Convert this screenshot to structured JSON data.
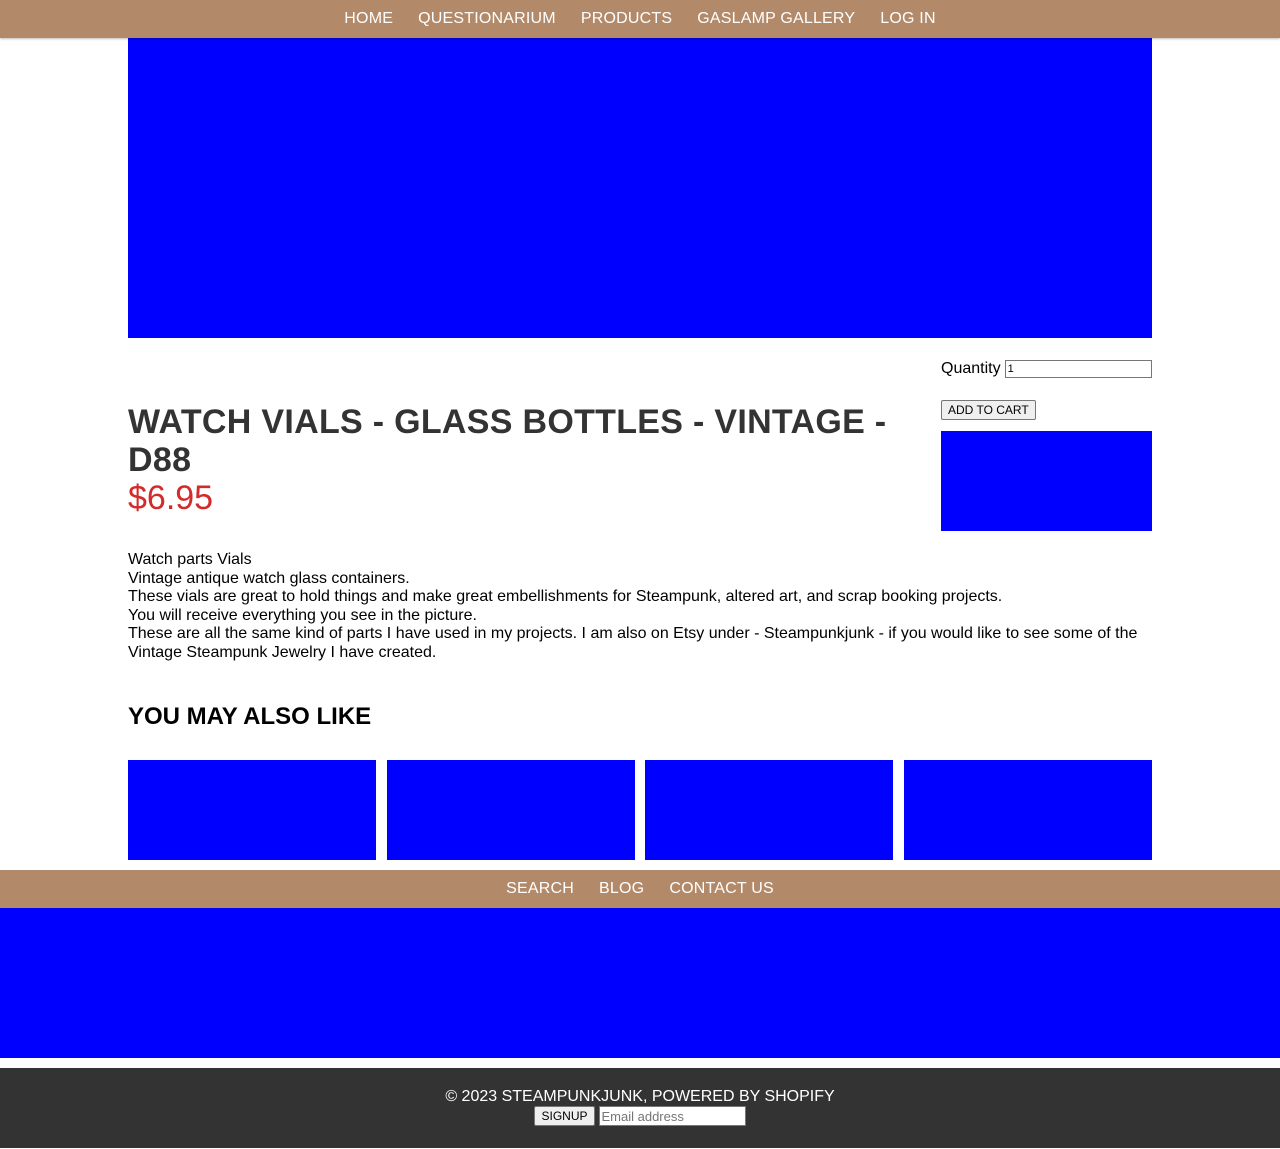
{
  "top_nav": {
    "items": [
      "HOME",
      "QUESTIONARIUM",
      "PRODUCTS",
      "GASLAMP GALLERY",
      "LOG IN"
    ]
  },
  "product": {
    "title": "WATCH VIALS - GLASS BOTTLES - VINTAGE - D88",
    "price": "$6.95",
    "quantity_label": "Quantity",
    "quantity_value": "1",
    "add_to_cart_label": "ADD TO CART",
    "description": [
      "Watch parts Vials",
      "Vintage antique watch glass containers.",
      "These vials are great to hold things and make great embellishments for Steampunk, altered art, and scrap booking projects.",
      "You will receive everything you see in the picture.",
      "These are all the same kind of parts I have used in my projects. I am also on Etsy under - Steampunkjunk - if you would like to see some of the Vintage Steampunk Jewelry I have created."
    ]
  },
  "related": {
    "heading": "YOU MAY ALSO LIKE",
    "count": 4
  },
  "footer_nav": {
    "items": [
      "SEARCH",
      "BLOG",
      "CONTACT US"
    ]
  },
  "footer": {
    "copyright": "© 2023 STEAMPUNKJUNK, POWERED BY SHOPIFY",
    "signup_label": "SIGNUP",
    "email_placeholder": "Email address"
  },
  "colors": {
    "nav_bg": "#b38a69",
    "placeholder_image": "#0000ff",
    "price": "#d42a2a",
    "title": "#333333",
    "footer_bg": "#333333"
  }
}
